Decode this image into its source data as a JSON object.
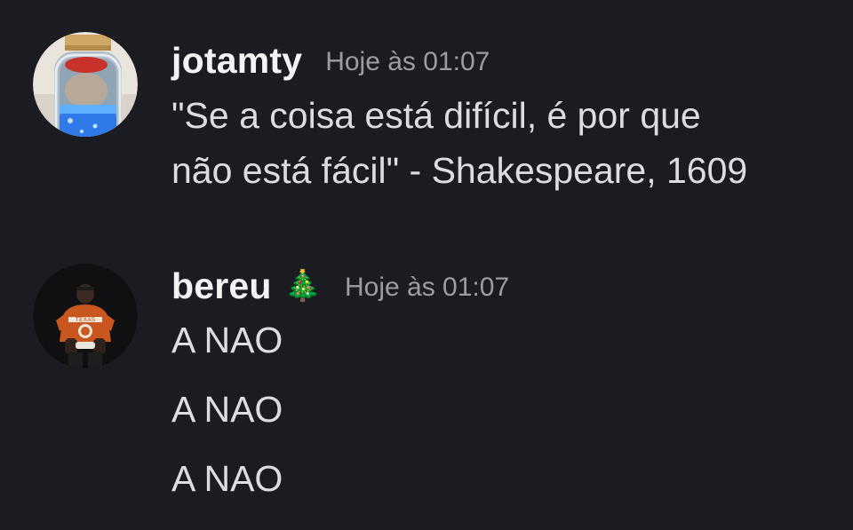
{
  "messages": [
    {
      "username": "jotamty",
      "timestamp": "Hoje às 01:07",
      "avatar_icon": "jar-with-cat-avatar",
      "lines": [
        "\"Se a coisa está difícil, é por que",
        "não está fácil\" - Shakespeare, 1609"
      ]
    },
    {
      "username": "bereu",
      "badge": "🎄",
      "timestamp": "Hoje às 01:07",
      "avatar_icon": "football-player-avatar",
      "lines": [
        "A NAO",
        "A NAO",
        "A NAO"
      ]
    }
  ],
  "colors": {
    "background": "#1b1c21",
    "username": "#f2f3f5",
    "timestamp": "#9b9da5",
    "text": "#dcdde1"
  }
}
